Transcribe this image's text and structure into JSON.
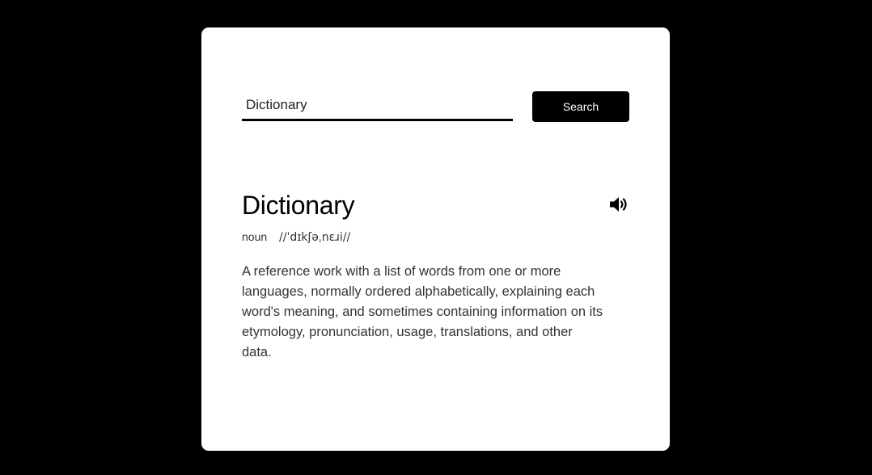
{
  "search": {
    "value": "Dictionary",
    "button_label": "Search"
  },
  "entry": {
    "word": "Dictionary",
    "part_of_speech": "noun",
    "phonetic": "//ˈdɪkʃəˌnɛɹi//",
    "definition": "A reference work with a list of words from one or more languages, normally ordered alphabetically, explaining each word's meaning, and sometimes containing information on its etymology, pronunciation, usage, translations, and other data.",
    "audio_icon": "speaker-volume-icon"
  },
  "colors": {
    "background": "#000000",
    "card": "#ffffff",
    "accent": "#000000",
    "text": "#333333"
  }
}
